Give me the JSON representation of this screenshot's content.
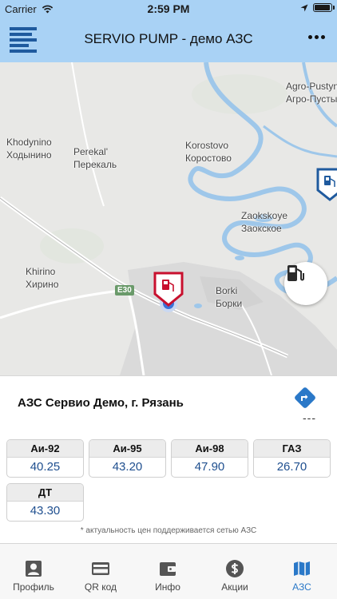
{
  "status_bar": {
    "carrier": "Carrier",
    "time": "2:59 PM",
    "battery_percent": 95
  },
  "nav": {
    "title": "SERVIO PUMP - демо АЗС",
    "menu_icon": "hamburger-logo-icon",
    "more_icon": "more-dots-icon"
  },
  "map": {
    "labels": {
      "agro_en": "Agro-Pustyn",
      "agro_ru": "Агро-Пусты",
      "khodynino_en": "Khodynino",
      "khodynino_ru": "Ходынино",
      "perekal_en": "Perekal'",
      "perekal_ru": "Перекаль",
      "korostovo_en": "Korostovo",
      "korostovo_ru": "Коростово",
      "zaokskoye_en": "Zaokskoye",
      "zaokskoye_ru": "Заокское",
      "khirino_en": "Khirino",
      "khirino_ru": "Хирино",
      "borki_en": "Borki",
      "borki_ru": "Борки",
      "road": "E30"
    },
    "colors": {
      "land": "#e8e8e6",
      "water": "#9ec7ea",
      "urban": "#d9d9d9",
      "marker_red": "#c8102e",
      "marker_blue": "#1f5a9e"
    },
    "fuel_button_icon": "fuel-pump-icon"
  },
  "station": {
    "name": "АЗС Сервио Демо, г. Рязань",
    "route_icon": "directions-icon",
    "distance": "---",
    "prices": [
      {
        "fuel": "Аи-92",
        "price": "40.25"
      },
      {
        "fuel": "Аи-95",
        "price": "43.20"
      },
      {
        "fuel": "Аи-98",
        "price": "47.90"
      },
      {
        "fuel": "ГАЗ",
        "price": "26.70"
      },
      {
        "fuel": "ДТ",
        "price": "43.30"
      }
    ],
    "note": "* актуальность цен поддерживается сетью АЗС"
  },
  "tabs": [
    {
      "label": "Профиль",
      "icon": "profile-icon",
      "active": false
    },
    {
      "label": "QR код",
      "icon": "card-icon",
      "active": false
    },
    {
      "label": "Инфо",
      "icon": "wallet-icon",
      "active": false
    },
    {
      "label": "Акции",
      "icon": "dollar-icon",
      "active": false
    },
    {
      "label": "АЗС",
      "icon": "map-icon",
      "active": true
    }
  ],
  "colors": {
    "header": "#a9d2f5",
    "accent": "#2a78c8",
    "price_text": "#1f4f8f"
  }
}
